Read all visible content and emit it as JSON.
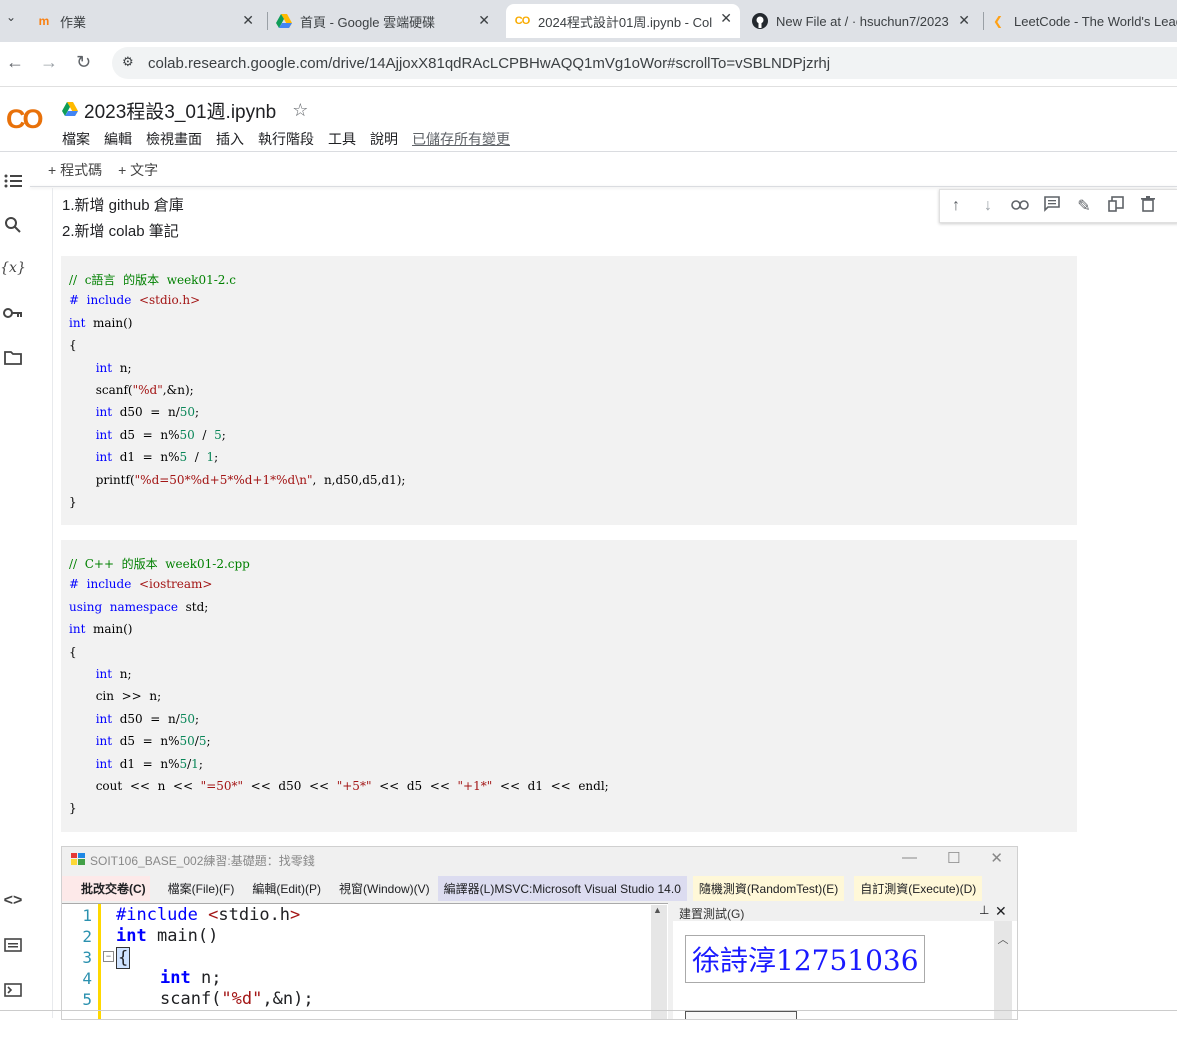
{
  "browser": {
    "tabs": [
      {
        "title": "作業",
        "icon": "moodle-icon"
      },
      {
        "title": "首頁 - Google 雲端硬碟",
        "icon": "google-drive-icon"
      },
      {
        "title": "2024程式設計01周.ipynb - Col",
        "icon": "colab-icon",
        "active": true
      },
      {
        "title": "New File at / · hsuchun7/2023",
        "icon": "github-icon"
      },
      {
        "title": "LeetCode - The World's Lead",
        "icon": "leetcode-icon"
      }
    ],
    "url": "colab.research.google.com/drive/14AjjoxX81qdRAcLCPBHwAQQ1mVg1oWor#scrollTo=vSBLNDPjzrhj"
  },
  "colab": {
    "logo": "CO",
    "notebook_title": "2023程設3_01週.ipynb",
    "menu": [
      "檔案",
      "編輯",
      "檢視畫面",
      "插入",
      "執行階段",
      "工具",
      "說明"
    ],
    "save_state": "已儲存所有變更",
    "toolbar": {
      "add_code": "+ 程式碼",
      "add_text": "+ 文字"
    }
  },
  "notebook": {
    "markdown": [
      "1.新增 github 倉庫",
      "2.新增 colab 筆記"
    ],
    "c_code": [
      [
        {
          "t": "//  c語言  的版本  week01-2.c",
          "c": "cm"
        }
      ],
      [
        {
          "t": "#  include  ",
          "c": "kw"
        },
        {
          "t": "<stdio.h>",
          "c": "st"
        }
      ],
      [
        {
          "t": "int",
          "c": "kw"
        },
        {
          "t": "  main()",
          "c": "tx"
        }
      ],
      [
        {
          "t": "{",
          "c": "tx"
        }
      ],
      [
        {
          "t": "       int",
          "c": "kw"
        },
        {
          "t": "  n;",
          "c": "tx"
        }
      ],
      [
        {
          "t": "       scanf(",
          "c": "tx"
        },
        {
          "t": "\"%d\"",
          "c": "st"
        },
        {
          "t": ",&n);",
          "c": "tx"
        }
      ],
      [
        {
          "t": "       int",
          "c": "kw"
        },
        {
          "t": "  d50  =  n/",
          "c": "tx"
        },
        {
          "t": "50",
          "c": "nm"
        },
        {
          "t": ";",
          "c": "tx"
        }
      ],
      [
        {
          "t": "       int",
          "c": "kw"
        },
        {
          "t": "  d5  =  n%",
          "c": "tx"
        },
        {
          "t": "50",
          "c": "nm"
        },
        {
          "t": "  /  ",
          "c": "tx"
        },
        {
          "t": "5",
          "c": "nm"
        },
        {
          "t": ";",
          "c": "tx"
        }
      ],
      [
        {
          "t": "       int",
          "c": "kw"
        },
        {
          "t": "  d1  =  n%",
          "c": "tx"
        },
        {
          "t": "5",
          "c": "nm"
        },
        {
          "t": "  /  ",
          "c": "tx"
        },
        {
          "t": "1",
          "c": "nm"
        },
        {
          "t": ";",
          "c": "tx"
        }
      ],
      [
        {
          "t": "       printf(",
          "c": "tx"
        },
        {
          "t": "\"%d=50*%d+5*%d+1*%d\\n\"",
          "c": "st"
        },
        {
          "t": ",  n,d50,d5,d1);",
          "c": "tx"
        }
      ],
      [
        {
          "t": "}",
          "c": "tx"
        }
      ]
    ],
    "cpp_code": [
      [
        {
          "t": "//  C++  的版本  week01-2.cpp",
          "c": "cm"
        }
      ],
      [
        {
          "t": "#  include  ",
          "c": "kw"
        },
        {
          "t": "<iostream>",
          "c": "st"
        }
      ],
      [
        {
          "t": "using  namespace",
          "c": "kw"
        },
        {
          "t": "  std;",
          "c": "tx"
        }
      ],
      [
        {
          "t": "int",
          "c": "kw"
        },
        {
          "t": "  main()",
          "c": "tx"
        }
      ],
      [
        {
          "t": "{",
          "c": "tx"
        }
      ],
      [
        {
          "t": "       int",
          "c": "kw"
        },
        {
          "t": "  n;",
          "c": "tx"
        }
      ],
      [
        {
          "t": "       cin  >>  n;",
          "c": "tx"
        }
      ],
      [
        {
          "t": "       int",
          "c": "kw"
        },
        {
          "t": "  d50  =  n/",
          "c": "tx"
        },
        {
          "t": "50",
          "c": "nm"
        },
        {
          "t": ";",
          "c": "tx"
        }
      ],
      [
        {
          "t": "       int",
          "c": "kw"
        },
        {
          "t": "  d5  =  n%",
          "c": "tx"
        },
        {
          "t": "50",
          "c": "nm"
        },
        {
          "t": "/",
          "c": "tx"
        },
        {
          "t": "5",
          "c": "nm"
        },
        {
          "t": ";",
          "c": "tx"
        }
      ],
      [
        {
          "t": "       int",
          "c": "kw"
        },
        {
          "t": "  d1  =  n%",
          "c": "tx"
        },
        {
          "t": "5",
          "c": "nm"
        },
        {
          "t": "/",
          "c": "tx"
        },
        {
          "t": "1",
          "c": "nm"
        },
        {
          "t": ";",
          "c": "tx"
        }
      ],
      [
        {
          "t": "       cout  <<  n  <<  ",
          "c": "tx"
        },
        {
          "t": "\"=50*\"",
          "c": "st"
        },
        {
          "t": "  <<  d50  <<  ",
          "c": "tx"
        },
        {
          "t": "\"+5*\"",
          "c": "st"
        },
        {
          "t": "  <<  d5  <<  ",
          "c": "tx"
        },
        {
          "t": "\"+1*\"",
          "c": "st"
        },
        {
          "t": "  <<  d1  <<  endl;",
          "c": "tx"
        }
      ],
      [
        {
          "t": "}",
          "c": "tx"
        }
      ]
    ]
  },
  "embedded_window": {
    "title": "SOIT106_BASE_002練習:基礎題：找零錢",
    "menu": [
      "批改交卷(C)",
      "檔案(File)(F)",
      "編輯(Edit)(P)",
      "視窗(Window)(V)",
      "編譯器(L)MSVC:Microsoft Visual Studio 14.0",
      "隨機測資(RandomTest)(E)",
      "自訂測資(Execute)(D)"
    ],
    "line_numbers": [
      "1",
      "2",
      "3",
      "4",
      "5"
    ],
    "panel_title": "建置測試(G)",
    "student": "徐詩淳12751036"
  }
}
